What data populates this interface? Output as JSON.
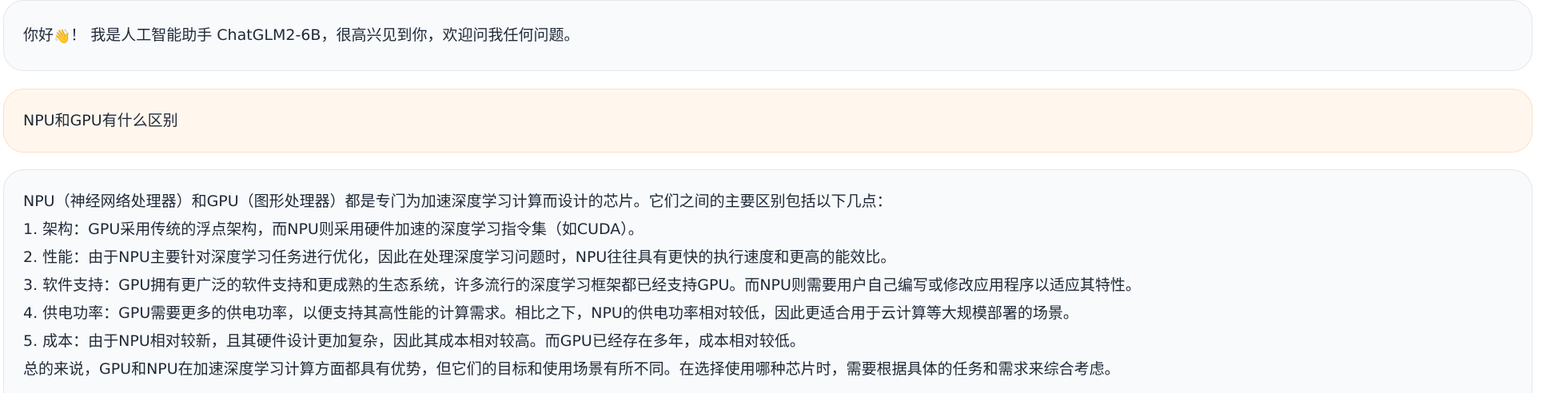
{
  "messages": [
    {
      "role": "bot",
      "text_before_emoji": "你好",
      "emoji": "👋",
      "text_after_emoji": "！ 我是人工智能助手 ChatGLM2-6B，很高兴见到你，欢迎问我任何问题。"
    },
    {
      "role": "user",
      "text": "NPU和GPU有什么区别"
    },
    {
      "role": "bot",
      "lines": [
        "NPU（神经网络处理器）和GPU（图形处理器）都是专门为加速深度学习计算而设计的芯片。它们之间的主要区别包括以下几点：",
        "1. 架构：GPU采用传统的浮点架构，而NPU则采用硬件加速的深度学习指令集（如CUDA）。",
        "2. 性能：由于NPU主要针对深度学习任务进行优化，因此在处理深度学习问题时，NPU往往具有更快的执行速度和更高的能效比。",
        "3. 软件支持：GPU拥有更广泛的软件支持和更成熟的生态系统，许多流行的深度学习框架都已经支持GPU。而NPU则需要用户自己编写或修改应用程序以适应其特性。",
        "4. 供电功率：GPU需要更多的供电功率，以便支持其高性能的计算需求。相比之下，NPU的供电功率相对较低，因此更适合用于云计算等大规模部署的场景。",
        "5. 成本：由于NPU相对较新，且其硬件设计更加复杂，因此其成本相对较高。而GPU已经存在多年，成本相对较低。",
        "总的来说，GPU和NPU在加速深度学习计算方面都具有优势，但它们的目标和使用场景有所不同。在选择使用哪种芯片时，需要根据具体的任务和需求来综合考虑。"
      ]
    }
  ]
}
